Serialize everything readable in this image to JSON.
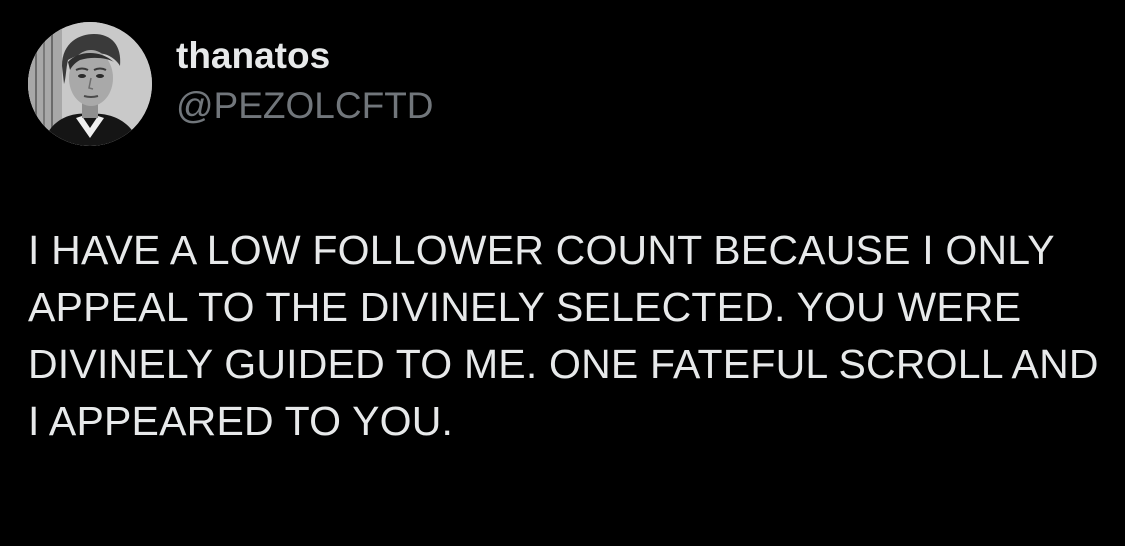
{
  "author": {
    "display_name": "thanatos",
    "handle": "@PEZOLCFTD",
    "avatar_icon": "profile-photo"
  },
  "tweet": {
    "text": "I HAVE A LOW FOLLOWER COUNT BECAUSE I ONLY APPEAL TO THE DIVINELY SELECTED. YOU WERE DIVINELY GUIDED TO ME. ONE FATEFUL SCROLL AND I APPEARED TO YOU."
  },
  "colors": {
    "background": "#000000",
    "primary_text": "#e7e9ea",
    "secondary_text": "#71767b"
  }
}
